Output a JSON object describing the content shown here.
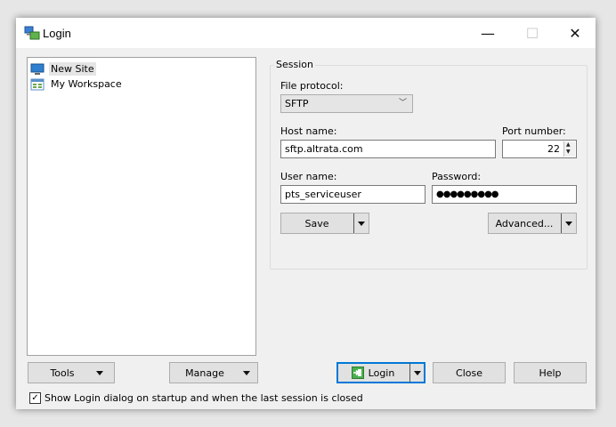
{
  "window": {
    "title": "Login",
    "minimize_glyph": "—",
    "maximize_glyph": "☐",
    "close_glyph": "✕"
  },
  "sites": {
    "items": [
      {
        "label": "New Site",
        "icon": "computer-icon",
        "selected": true
      },
      {
        "label": "My Workspace",
        "icon": "workspace-icon",
        "selected": false
      }
    ]
  },
  "session": {
    "group_label": "Session",
    "protocol_label": "File protocol:",
    "protocol_value": "SFTP",
    "host_label": "Host name:",
    "host_value": "sftp.altrata.com",
    "port_label": "Port number:",
    "port_value": "22",
    "user_label": "User name:",
    "user_value": "pts_serviceuser",
    "password_label": "Password:",
    "password_value": "●●●●●●●●●",
    "save_label": "Save",
    "advanced_label": "Advanced..."
  },
  "footer": {
    "tools_label": "Tools",
    "manage_label": "Manage",
    "login_label": "Login",
    "close_label": "Close",
    "help_label": "Help",
    "startup_checkbox_label": "Show Login dialog on startup and when the last session is closed",
    "startup_checked": true
  },
  "colors": {
    "accent": "#0078d7",
    "login_icon": "#3a9a3a"
  }
}
